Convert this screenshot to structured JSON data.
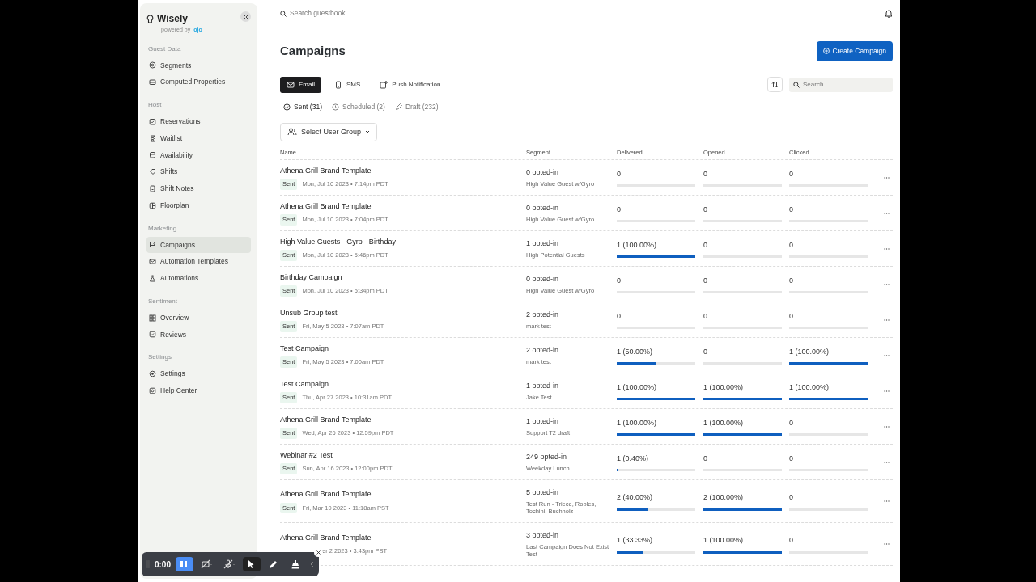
{
  "brand": {
    "name": "Wisely",
    "powered_by": "powered by",
    "partner": "ojo"
  },
  "sidebar": {
    "sections": [
      {
        "title": "Guest Data",
        "items": [
          {
            "label": "Segments",
            "selected": false
          },
          {
            "label": "Computed Properties",
            "selected": false
          }
        ]
      },
      {
        "title": "Host",
        "items": [
          {
            "label": "Reservations",
            "selected": false
          },
          {
            "label": "Waitlist",
            "selected": false
          },
          {
            "label": "Availability",
            "selected": false
          },
          {
            "label": "Shifts",
            "selected": false
          },
          {
            "label": "Shift Notes",
            "selected": false
          },
          {
            "label": "Floorplan",
            "selected": false
          }
        ]
      },
      {
        "title": "Marketing",
        "items": [
          {
            "label": "Campaigns",
            "selected": true
          },
          {
            "label": "Automation Templates",
            "selected": false
          },
          {
            "label": "Automations",
            "selected": false
          }
        ]
      },
      {
        "title": "Sentiment",
        "items": [
          {
            "label": "Overview",
            "selected": false
          },
          {
            "label": "Reviews",
            "selected": false
          }
        ]
      },
      {
        "title": "Settings",
        "items": [
          {
            "label": "Settings",
            "selected": false
          },
          {
            "label": "Help Center",
            "selected": false
          }
        ]
      }
    ]
  },
  "topbar": {
    "search": {
      "placeholder": "Search guestbook..."
    }
  },
  "page": {
    "title": "Campaigns",
    "create_button": "Create Campaign"
  },
  "channel_tabs": [
    {
      "label": "Email",
      "selected": true
    },
    {
      "label": "SMS",
      "selected": false
    },
    {
      "label": "Push Notification",
      "selected": false
    }
  ],
  "search": {
    "placeholder": "Search"
  },
  "status_tabs": [
    {
      "label": "Sent (31)",
      "selected": true
    },
    {
      "label": "Scheduled (2)",
      "selected": false
    },
    {
      "label": "Draft (232)",
      "selected": false
    }
  ],
  "user_group_select": "Select User Group",
  "table": {
    "columns": [
      "Name",
      "Segment",
      "Delivered",
      "Opened",
      "Clicked"
    ],
    "rows": [
      {
        "name": "Athena Grill Brand Template",
        "status": "Sent",
        "date": "Mon, Jul 10 2023 • 7:14pm PDT",
        "opted": "0 opted-in",
        "segment": "High Value Guest w/Gyro",
        "delivered": {
          "text": "0",
          "level": 0
        },
        "opened": {
          "text": "0",
          "level": 0
        },
        "clicked": {
          "text": "0",
          "level": 0
        }
      },
      {
        "name": "Athena Grill Brand Template",
        "status": "Sent",
        "date": "Mon, Jul 10 2023 • 7:04pm PDT",
        "opted": "0 opted-in",
        "segment": "High Value Guest w/Gyro",
        "delivered": {
          "text": "0",
          "level": 0
        },
        "opened": {
          "text": "0",
          "level": 0
        },
        "clicked": {
          "text": "0",
          "level": 0
        }
      },
      {
        "name": "High Value Guests - Gyro - Birthday",
        "status": "Sent",
        "date": "Mon, Jul 10 2023 • 5:46pm PDT",
        "opted": "1 opted-in",
        "segment": "High Potential Guests",
        "delivered": {
          "text": "1 (100.00%)",
          "level": 1
        },
        "opened": {
          "text": "0",
          "level": 0
        },
        "clicked": {
          "text": "0",
          "level": 0
        }
      },
      {
        "name": "Birthday Campaign",
        "status": "Sent",
        "date": "Mon, Jul 10 2023 • 5:34pm PDT",
        "opted": "0 opted-in",
        "segment": "High Value Guest w/Gyro",
        "delivered": {
          "text": "0",
          "level": 0
        },
        "opened": {
          "text": "0",
          "level": 0
        },
        "clicked": {
          "text": "0",
          "level": 0
        }
      },
      {
        "name": "Unsub Group test",
        "status": "Sent",
        "date": "Fri, May 5 2023 • 7:07am PDT",
        "opted": "2 opted-in",
        "segment": "mark test",
        "delivered": {
          "text": "0",
          "level": 0
        },
        "opened": {
          "text": "0",
          "level": 0
        },
        "clicked": {
          "text": "0",
          "level": 0
        }
      },
      {
        "name": "Test Campaign",
        "status": "Sent",
        "date": "Fri, May 5 2023 • 7:00am PDT",
        "opted": "2 opted-in",
        "segment": "mark test",
        "delivered": {
          "text": "1 (50.00%)",
          "level": 0.5
        },
        "opened": {
          "text": "0",
          "level": 0
        },
        "clicked": {
          "text": "1 (100.00%)",
          "level": 1
        }
      },
      {
        "name": "Test Campaign",
        "status": "Sent",
        "date": "Thu, Apr 27 2023 • 10:31am PDT",
        "opted": "1 opted-in",
        "segment": "Jake Test",
        "delivered": {
          "text": "1 (100.00%)",
          "level": 1
        },
        "opened": {
          "text": "1 (100.00%)",
          "level": 1
        },
        "clicked": {
          "text": "1 (100.00%)",
          "level": 1
        }
      },
      {
        "name": "Athena Grill Brand Template",
        "status": "Sent",
        "date": "Wed, Apr 26 2023 • 12:59pm PDT",
        "opted": "1 opted-in",
        "segment": "Support T2 draft",
        "delivered": {
          "text": "1 (100.00%)",
          "level": 1
        },
        "opened": {
          "text": "1 (100.00%)",
          "level": 1
        },
        "clicked": {
          "text": "0",
          "level": 0
        }
      },
      {
        "name": "Webinar #2 Test",
        "status": "Sent",
        "date": "Sun, Apr 16 2023 • 12:00pm PDT",
        "opted": "249 opted-in",
        "segment": "Weekday Lunch",
        "delivered": {
          "text": "1 (0.40%)",
          "level": 0.004
        },
        "opened": {
          "text": "0",
          "level": 0
        },
        "clicked": {
          "text": "0",
          "level": 0
        }
      },
      {
        "name": "Athena Grill Brand Template",
        "status": "Sent",
        "date": "Fri, Mar 10 2023 • 11:18am PST",
        "opted": "5 opted-in",
        "segment": "Test Run - Triece, Robles, Tochini, Buchholz",
        "delivered": {
          "text": "2 (40.00%)",
          "level": 0.4
        },
        "opened": {
          "text": "2 (100.00%)",
          "level": 1
        },
        "clicked": {
          "text": "0",
          "level": 0
        }
      },
      {
        "name": "Athena Grill Brand Template",
        "date": "er 2 2023 • 3:43pm PST",
        "opted": "3 opted-in",
        "segment": "Last Campaign Does Not Exist Test",
        "delivered": {
          "text": "1 (33.33%)",
          "level": 0.3333
        },
        "opened": {
          "text": "1 (100.00%)",
          "level": 1
        },
        "clicked": {
          "text": "0",
          "level": 0
        }
      }
    ]
  },
  "recorder": {
    "time": "0:00",
    "tools": [
      {
        "kind": "pause",
        "selected": true
      },
      {
        "kind": "camera",
        "selected": false
      },
      {
        "kind": "mic",
        "selected": false
      },
      {
        "kind": "pointer",
        "selected": true
      },
      {
        "kind": "pen",
        "selected": false
      },
      {
        "kind": "eraser",
        "selected": false
      }
    ]
  }
}
